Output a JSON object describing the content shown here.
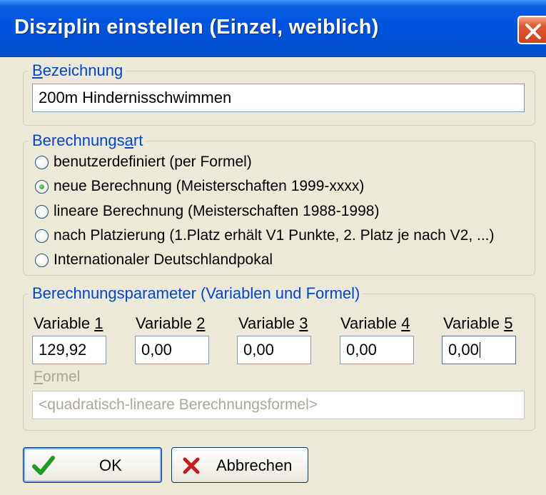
{
  "window": {
    "title": "Disziplin einstellen (Einzel, weiblich)",
    "close_icon": "close-x"
  },
  "bezeichnung": {
    "legend_accel": "B",
    "legend_rest": "ezeichnung",
    "value": "200m Hindernisschwimmen"
  },
  "berechnungsart": {
    "legend_pre": "Berechnungs",
    "legend_accel": "a",
    "legend_post": "rt",
    "options": [
      {
        "label": "benutzerdefiniert (per Formel)",
        "selected": false
      },
      {
        "label": "neue Berechnung (Meisterschaften 1999-xxxx)",
        "selected": true
      },
      {
        "label": "lineare Berechnung (Meisterschaften 1988-1998)",
        "selected": false
      },
      {
        "label": "nach Platzierung (1.Platz erhält V1 Punkte, 2. Platz je nach V2, ...)",
        "selected": false
      },
      {
        "label": "Internationaler Deutschlandpokal",
        "selected": false
      }
    ]
  },
  "parameter": {
    "legend": "Berechnungsparameter (Variablen und Formel)",
    "variables": [
      {
        "label_pre": "Variable ",
        "accel": "1",
        "value": "129,92"
      },
      {
        "label_pre": "Variable ",
        "accel": "2",
        "value": "0,00"
      },
      {
        "label_pre": "Variable ",
        "accel": "3",
        "value": "0,00"
      },
      {
        "label_pre": "Variable ",
        "accel": "4",
        "value": "0,00"
      },
      {
        "label_pre": "Variable ",
        "accel": "5",
        "value": "0,00"
      }
    ],
    "formel_label_accel": "F",
    "formel_label_rest": "ormel",
    "formel_value": "<quadratisch-lineare Berechnungsformel>"
  },
  "buttons": {
    "ok_label": "OK",
    "ok_icon": "checkmark-icon",
    "cancel_label": "Abbrechen",
    "cancel_icon": "x-cross-icon"
  },
  "colors": {
    "titlebar": "#0054e3",
    "legend": "#0046d5",
    "close_button": "#d0421d",
    "ok_check": "#1e9e1e",
    "cancel_x": "#c41e1e",
    "disabled_text": "#aca899"
  }
}
